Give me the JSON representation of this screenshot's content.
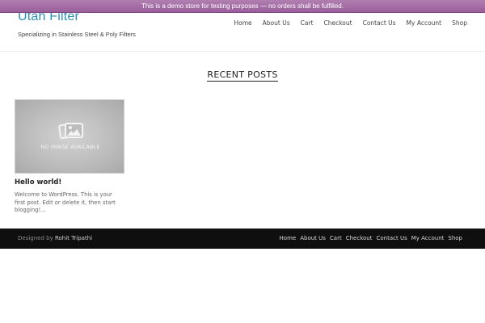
{
  "demo_notice": "This is a demo store for testing purposes — no orders shall be fulfilled.",
  "site": {
    "title": "Utah Filter",
    "description": "Specializing in Stainless Steel & Poly Filters"
  },
  "main_nav": [
    "Home",
    "About Us",
    "Cart",
    "Checkout",
    "Contact Us",
    "My Account",
    "Shop"
  ],
  "section_title": "RECENT POSTS",
  "post": {
    "thumbnail_text": "NO IMAGE AVAILABLE",
    "thumbnail_icon": "image-placeholder-icon",
    "title": "Hello world!",
    "excerpt": "Welcome to WordPress. This is your first post. Edit or delete it, then start blogging!..."
  },
  "footer": {
    "designed_by": "Designed by",
    "author": "Rohit Tripathi",
    "nav": [
      "Home",
      "About Us",
      "Cart",
      "Checkout",
      "Contact Us",
      "My Account",
      "Shop"
    ]
  },
  "colors": {
    "notice_bar": "#9a5f9c",
    "site_title": "#2e8fb5",
    "footer_bg": "#0f0f0f"
  }
}
